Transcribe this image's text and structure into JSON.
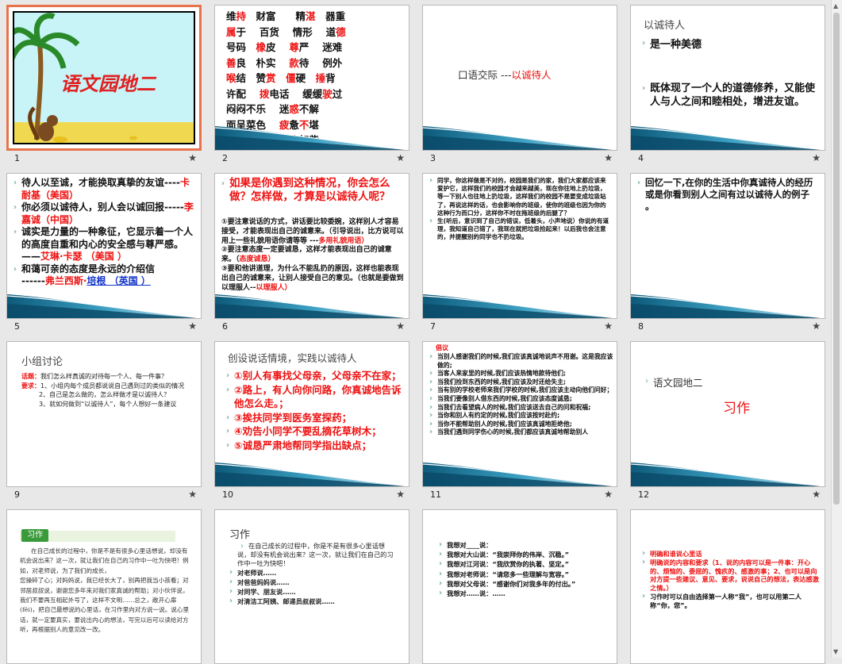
{
  "footers": [
    "1",
    "2",
    "3",
    "4",
    "5",
    "6",
    "7",
    "8",
    "9",
    "10",
    "11",
    "12"
  ],
  "star": "★",
  "s1": {
    "title": "语文园地二"
  },
  "s2": {
    "lines": [
      [
        "维",
        "持",
        "　财富　　精",
        "湛",
        "　器重"
      ],
      [
        " ",
        "属",
        "于　 百货　 情形　 道",
        "德",
        ""
      ],
      [
        "号码　",
        "橡",
        "皮　 ",
        "尊",
        "严　 迷难",
        ""
      ],
      [
        " ",
        "善",
        "良　朴实　 ",
        "款",
        "待　 例外"
      ],
      [
        " ",
        "喉",
        "结　赞",
        "赏",
        "　",
        "僵",
        "硬　",
        "捶",
        "背"
      ],
      [
        "许配　 ",
        "拨",
        "电话　 缓缓",
        "驶",
        "过"
      ],
      [
        "闷闷不乐　 迷",
        "惑",
        "不解"
      ],
      [
        "面呈菜色　 ",
        "疲",
        "惫",
        "不",
        "堪"
      ],
      [
        "狼吞虎咽　 骨",
        "瘦",
        "如柴"
      ]
    ]
  },
  "s3": {
    "prefix": "口语交际 ---",
    "title": "以诚待人"
  },
  "s4": {
    "title": "以诚待人",
    "line1": "是一种美德",
    "line2": "既体现了一个人的道德修养，又能使人与人之间和睦相处，增进友谊。"
  },
  "s5": {
    "q1": "待人以至诚，才能换取真挚的友谊----",
    "q1a": "卡耐基（美国）",
    "q2": "你必须以诚待人，别人会以诚回报-----",
    "q2a": "李嘉诚（中国）",
    "q3": "诚实是力量的一种象征，它显示着一个人的高度自重和内心的安全感与尊严感。 ——",
    "q3a": "艾琳·卡瑟 （美国 ）",
    "q4": "和蔼可亲的态度是永远的介绍信",
    "q4p": "------",
    "q4a": "弗兰西斯·",
    "q4b": "培根 （英国 ）"
  },
  "s6": {
    "head": "如果是你遇到这种情况，你会怎么做？怎样做，才算是以诚待人呢？",
    "p1": "①要注意说话的方式，讲话要比较委婉，这样别人才容易接受，才能表现出自己的诚意来。（引导说出，比方说可以用上一些礼貌用语你请等等 ---",
    "p1r": "多用礼貌用语）",
    "p2": "②要注意态度一定要诚恳，这样才能表现出自己的诚意来。（",
    "p2r": "态度诚恳）",
    "p3": "③要和他讲道理，为什么不能乱扔的原因，这样也能表现出自己的诚意来，让别人接受自己的意见。（也就是要做到以理服人--",
    "p3r": "以理服人）"
  },
  "s7": {
    "p1": "同学，你这样做是不对的，校园是我们的家，我们大家都应该来爱护它，这样我们的校园才会越来越美，现在你往地上扔垃圾，等一下别人也往地上扔垃圾，这样我们的校园不是要变成垃圾站了，再说这样的话，也会影响你的班级，使你的班级也因为你的这种行为而口分，这样你不时在拖班级的后腿了？",
    "p2": "生(听后，意识到了自己的错误，低着头，小声地说）你说的有道理，我知道自己错了，我现在就把垃圾捡起来！以后我也会注意的，并提醒别的同学也不扔垃圾。"
  },
  "s8": {
    "text": "回忆一下,在你的生活中你真诚待人的经历或是你看到别人之间有过以诚待人的例子 。"
  },
  "s9": {
    "title": "小组讨论",
    "l1k": "话题：",
    "l1": "我们怎么样真诚的对待每一个人、每一件事？",
    "l2k": "要求：",
    "l2": "1、小组内每个成员都说说自己遇到过的类似的情况",
    "l3": "2、自己是怎么做的，怎么样做才是以诚待人？",
    "l4": "3、就如何做到“以诚待人”，每个人想好一条建议"
  },
  "s10": {
    "title": "创设说话情境，实践以诚待人",
    "items": [
      "①别人有事找父母亲，父母亲不在家；",
      "②路上，有人向你问路，你真诚地告诉他怎么走。；",
      "③挨扶同学到医务室探药；",
      "④劝告小同学不要乱摘花草树木；",
      "⑤诚恳严肃地帮同学指出缺点；"
    ]
  },
  "s11": {
    "head": "倡议",
    "items": [
      "当别人感谢我们的时候,我们应该真诚地说声不用谢。这是我应该做的;",
      "当客人来家里的时候,我们应该热情地款待他们;",
      "当我们捡到东西的时候,我们应该及时还给失主;",
      "当有别的学校老师来我们学校的时候,我们应该主动向他们问好；",
      "当我们要像别人借东西的时候,我们应该态度诚恳;",
      "当我们去看望病人的时候,我们应该送去自己的问和祝福;",
      "当你和别人有约定的时候,我们应该按时赴约;",
      "当你不能帮助别人的时候,我们应该真诚地拒绝他;",
      "当我们遇到同学伤心的时候,我们都应该真诚地帮助别人"
    ]
  },
  "s12": {
    "line1": "语文园地二",
    "line2": "习作"
  },
  "s13": {
    "banner": "习作",
    "paragraphs": [
      "在自己成长的过程中，你是不是有很多心里话想说，却没有机会说出来？这一次，就让我们在自己的习作中一吐为快吧！例如，对老师说，为了我们的成长，",
      "您操碎了心；对妈妈说，我已经长大了，别再把我当小孩看；对邻居叔叔说，谢谢您多年来对我们家真诚的帮助；对小伙伴说，我们不要再互相起外号了，这样不文明……总之，敞开心扉(fēi)，把自己最想说的心里话，在习作里向对方说一说。说心里话，就一定要真实，要说出内心的想法，写完以后可以读给对方听，再根据别人的意见改一改。"
    ]
  },
  "s14": {
    "title": "习作",
    "intro": "在自己成长的过程中，你是不是有很多心里话想说，却没有机会说出来？这一次，就让我们在自己的习作中一吐为快吧！",
    "items": [
      "对老师说……",
      "对爸爸妈妈说……",
      "对同学、朋友说……",
      "对清洁工阿姨、邮递员叔叔说……"
    ]
  },
  "s15": {
    "items": [
      "我想对____说：",
      "我想对大山说：“我崇拜你的伟岸、沉稳。”",
      "我想对江河说：“我欣赏你的执著、坚定。”",
      "我想对老师说：“请您多一些理解与宽容。”",
      "我想对父母说：“感谢你们对我多年的付出。”",
      "我想对……说：……"
    ]
  },
  "s16": {
    "l1": "明确和谁说心里话",
    "l2a": "明确说的内容和要求",
    "l2b": "（1、说的内容可以是一件事：开心的、烦恼的、委屈的、愧疚的、感激的事；2、也可以是向对方提一些建议、意见、要求，说说自己的想法，表达感激之情。）",
    "l3": "习作时可以自由选择第一人称“我”，也可以用第二人称“你，您”。"
  }
}
